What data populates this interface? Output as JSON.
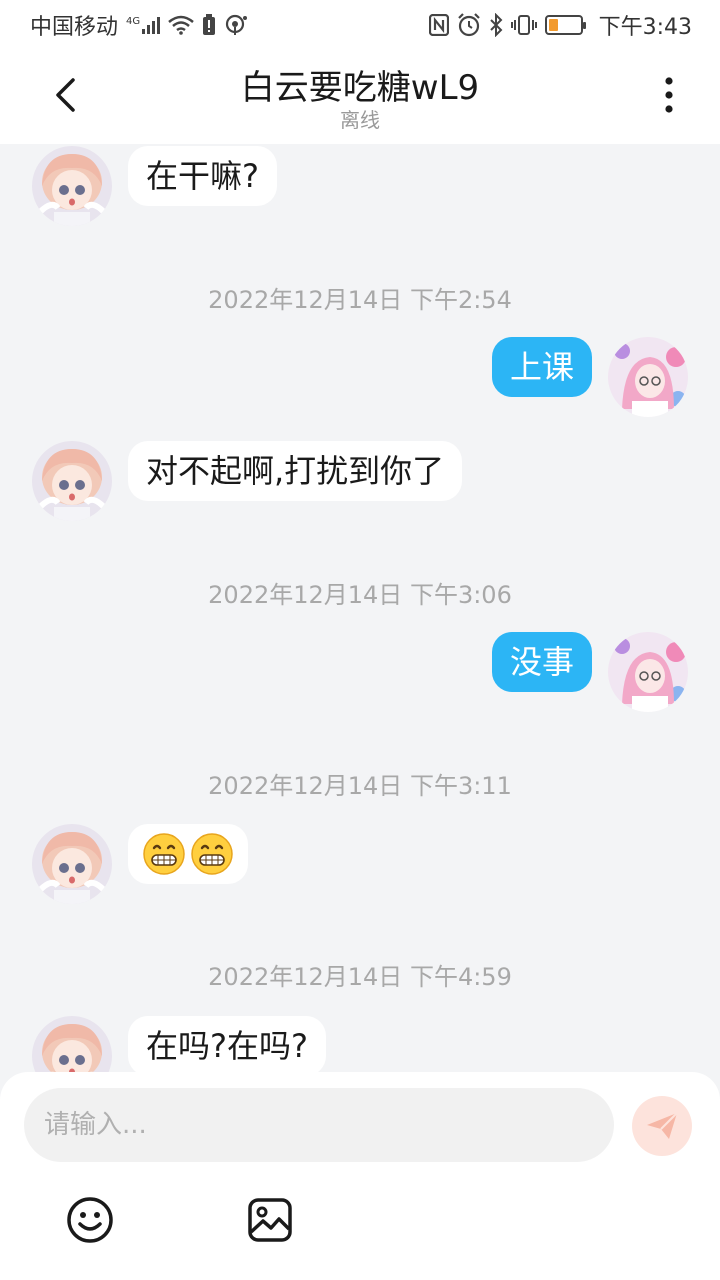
{
  "status_bar": {
    "carrier": "中国移动",
    "network": "4G",
    "time": "下午3:43",
    "battery_level": 0.3,
    "icons": [
      "signal-icon",
      "wifi-icon",
      "battery-alert-icon",
      "hotspot-icon",
      "nfc-icon",
      "alarm-icon",
      "bluetooth-icon",
      "vibrate-icon",
      "battery-icon"
    ]
  },
  "header": {
    "title": "白云要吃糖wL9",
    "status": "离线",
    "back_icon": "chevron-left-icon",
    "more_icon": "more-vertical-icon"
  },
  "messages": [
    {
      "type": "in",
      "text": "在干嘛?"
    },
    {
      "type": "time",
      "text": "2022年12月14日 下午2:54"
    },
    {
      "type": "out",
      "text": "上课"
    },
    {
      "type": "in",
      "text": "对不起啊,打扰到你了"
    },
    {
      "type": "time",
      "text": "2022年12月14日 下午3:06"
    },
    {
      "type": "out",
      "text": "没事"
    },
    {
      "type": "time",
      "text": "2022年12月14日 下午3:11"
    },
    {
      "type": "in",
      "text": "😁😁"
    },
    {
      "type": "time",
      "text": "2022年12月14日 下午4:59"
    },
    {
      "type": "in",
      "text": "在吗?在吗?"
    }
  ],
  "input": {
    "placeholder": "请输入...",
    "send_icon": "send-icon",
    "emoji_icon": "emoji-icon",
    "image_icon": "image-icon"
  },
  "colors": {
    "accent": "#2cb5f5",
    "background": "#f3f4f6",
    "send_button": "#fde3dc"
  }
}
